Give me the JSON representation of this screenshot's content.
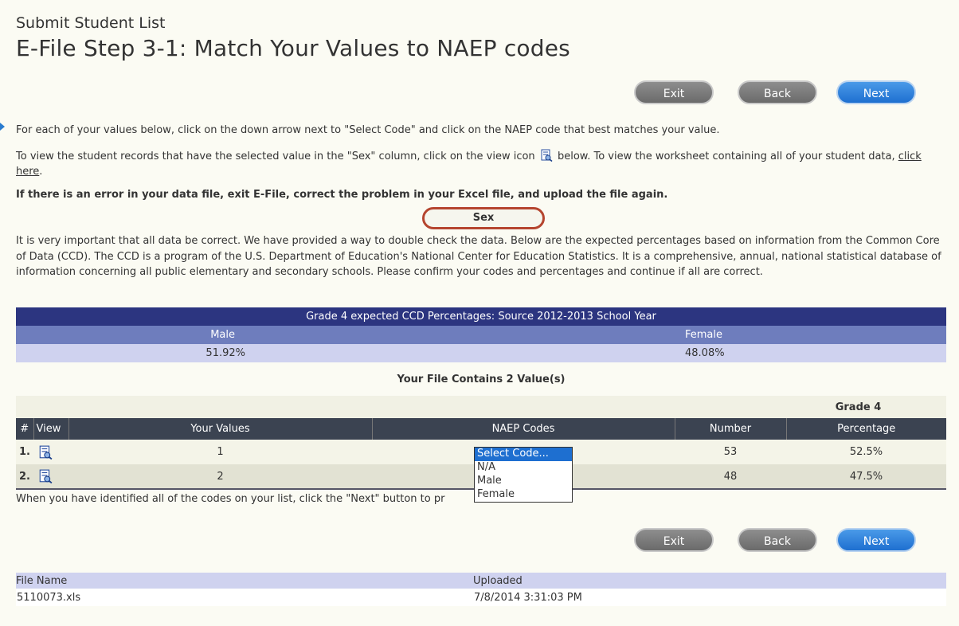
{
  "header": {
    "subtitle": "Submit Student List",
    "title": "E-File Step 3-1: Match Your Values to NAEP codes"
  },
  "nav": {
    "exit_label": "Exit",
    "back_label": "Back",
    "next_label": "Next"
  },
  "instructions": {
    "line1": "For each of your values below, click on the down arrow next to \"Select Code\" and click on the NAEP code that best matches your value.",
    "line2_a": "To view the student records that have the selected value in the \"Sex\" column, click on the view icon",
    "line2_b": "below. To view the worksheet containing all of your student data,",
    "link": "click here",
    "line2_end": ".",
    "error_note": "If there is an error in your data file, exit E-File, correct the problem in your Excel file, and upload the file again."
  },
  "field_label": "Sex",
  "ccd_note": "It is very important that all data be correct. We have provided a way to double check the data. Below are the expected percentages based on information from the Common Core of Data (CCD). The CCD is a program of the U.S. Department of Education's National Center for Education Statistics. It is a comprehensive, annual, national statistical database of information concerning all public elementary and secondary schools. Please confirm your codes and percentages and continue if all are correct.",
  "ccd_table": {
    "title": "Grade 4 expected CCD Percentages: Source 2012-2013 School Year",
    "columns": [
      "Male",
      "Female"
    ],
    "values": [
      "51.92%",
      "48.08%"
    ]
  },
  "contains_label": "Your File Contains 2 Value(s)",
  "values_table": {
    "grade_label": "Grade 4",
    "headers": {
      "num": "#",
      "view": "View",
      "your_values": "Your Values",
      "naep_codes": "NAEP Codes",
      "number": "Number",
      "percentage": "Percentage"
    },
    "rows": [
      {
        "num": "1.",
        "value": "1",
        "number": "53",
        "percentage": "52.5%"
      },
      {
        "num": "2.",
        "value": "2",
        "number": "48",
        "percentage": "47.5%"
      }
    ]
  },
  "dropdown": {
    "options": [
      "Select Code...",
      "N/A",
      "Male",
      "Female"
    ],
    "selected": "Select Code..."
  },
  "footer_note_visible": "When you have identified all of the codes on your list, click the \"Next\" button to pr",
  "files": {
    "headers": [
      "File Name",
      "Uploaded"
    ],
    "row": [
      "5110073.xls",
      "7/8/2014 3:31:03 PM"
    ]
  },
  "colors": {
    "accent_blue": "#1e6fd0",
    "header_navy": "#2c3580",
    "highlight_ring": "#b5452f"
  }
}
